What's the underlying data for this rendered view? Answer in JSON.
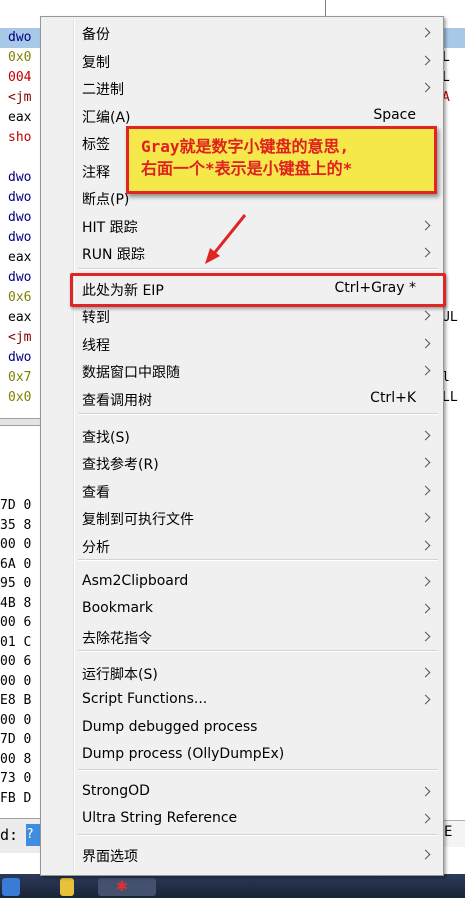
{
  "background": {
    "left_lines": [
      {
        "text": "dwo",
        "color": "#000080",
        "hl": true
      },
      {
        "text": "0x0",
        "color": "#808000"
      },
      {
        "text": "004",
        "color": "#c00000"
      },
      {
        "text": "<jm",
        "color": "#800000"
      },
      {
        "text": "eax",
        "color": "#000000"
      },
      {
        "text": "sho",
        "color": "#c00000"
      },
      {
        "text": "",
        "color": "#000000"
      },
      {
        "text": "dwo",
        "color": "#000080"
      },
      {
        "text": "dwo",
        "color": "#000080"
      },
      {
        "text": "dwo",
        "color": "#000080"
      },
      {
        "text": "dwo",
        "color": "#000080"
      },
      {
        "text": "eax",
        "color": "#000000"
      },
      {
        "text": "dwo",
        "color": "#000080"
      },
      {
        "text": "0x6",
        "color": "#808000"
      },
      {
        "text": "eax",
        "color": "#000000"
      },
      {
        "text": "<jm",
        "color": "#800000"
      },
      {
        "text": "dwo",
        "color": "#000080"
      },
      {
        "text": "0x7",
        "color": "#808000"
      },
      {
        "text": "0x0",
        "color": "#808000"
      }
    ],
    "hex_lines": [
      "7D 0",
      "35 8",
      "00 0",
      "6A 0",
      "95 0",
      "4B 8",
      "00 6",
      "01 C",
      "00 6",
      "00 0",
      "E8 B",
      "00 0",
      "7D 0",
      "00 8",
      "73 0",
      "FB D"
    ],
    "right_lines": [
      {
        "text": "",
        "hl": true
      },
      {
        "text": "L"
      },
      {
        "text": "L"
      },
      {
        "text": "A",
        "color": "#c00000"
      },
      {
        "text": ""
      },
      {
        "text": ""
      },
      {
        "text": ""
      },
      {
        "text": ""
      },
      {
        "text": ""
      },
      {
        "text": ""
      },
      {
        "text": ""
      },
      {
        "text": ""
      },
      {
        "text": ""
      },
      {
        "text": ""
      },
      {
        "text": "UL"
      },
      {
        "text": ""
      },
      {
        "text": ""
      },
      {
        "text": "l"
      },
      {
        "text": "LL"
      }
    ],
    "cmd_label": "d:",
    "cmd_value": "?",
    "right_box_text": "E"
  },
  "menu": {
    "items": [
      {
        "label": "备份",
        "shortcut": "",
        "submenu": true
      },
      {
        "label": "复制",
        "shortcut": "",
        "submenu": true
      },
      {
        "label": "二进制",
        "shortcut": "",
        "submenu": true
      },
      {
        "label": "汇编(A)",
        "shortcut": "Space",
        "submenu": false
      },
      {
        "label": "标签",
        "shortcut": "",
        "submenu": false
      },
      {
        "label": "注释",
        "shortcut": "",
        "submenu": false
      },
      {
        "label": "断点(P)",
        "shortcut": "",
        "submenu": false
      },
      {
        "label": "HIT 跟踪",
        "shortcut": "",
        "submenu": true
      },
      {
        "label": "RUN 跟踪",
        "shortcut": "",
        "submenu": true
      },
      {
        "label": "此处为新 EIP",
        "shortcut": "Ctrl+Gray *",
        "submenu": false
      },
      {
        "label": "转到",
        "shortcut": "",
        "submenu": true
      },
      {
        "label": "线程",
        "shortcut": "",
        "submenu": true
      },
      {
        "label": "数据窗口中跟随",
        "shortcut": "",
        "submenu": true
      },
      {
        "label": "查看调用树",
        "shortcut": "Ctrl+K",
        "submenu": false
      },
      {
        "label": "查找(S)",
        "shortcut": "",
        "submenu": true
      },
      {
        "label": "查找参考(R)",
        "shortcut": "",
        "submenu": true
      },
      {
        "label": "查看",
        "shortcut": "",
        "submenu": true
      },
      {
        "label": "复制到可执行文件",
        "shortcut": "",
        "submenu": true
      },
      {
        "label": "分析",
        "shortcut": "",
        "submenu": true
      },
      {
        "label": "Asm2Clipboard",
        "shortcut": "",
        "submenu": true
      },
      {
        "label": "Bookmark",
        "shortcut": "",
        "submenu": true
      },
      {
        "label": "去除花指令",
        "shortcut": "",
        "submenu": true
      },
      {
        "label": "运行脚本(S)",
        "shortcut": "",
        "submenu": true
      },
      {
        "label": "Script Functions...",
        "shortcut": "",
        "submenu": true
      },
      {
        "label": "Dump debugged process",
        "shortcut": "",
        "submenu": false
      },
      {
        "label": "Dump process (OllyDumpEx)",
        "shortcut": "",
        "submenu": false
      },
      {
        "label": "StrongOD",
        "shortcut": "",
        "submenu": true
      },
      {
        "label": "Ultra String Reference",
        "shortcut": "",
        "submenu": true
      },
      {
        "label": "界面选项",
        "shortcut": "",
        "submenu": true
      }
    ]
  },
  "annotation": {
    "callout_line1": "Gray就是数字小键盘的意思,",
    "callout_line2": "右面一个*表示是小键盘上的*",
    "accent_color": "#e02525",
    "callout_bg": "#f5e84a"
  }
}
